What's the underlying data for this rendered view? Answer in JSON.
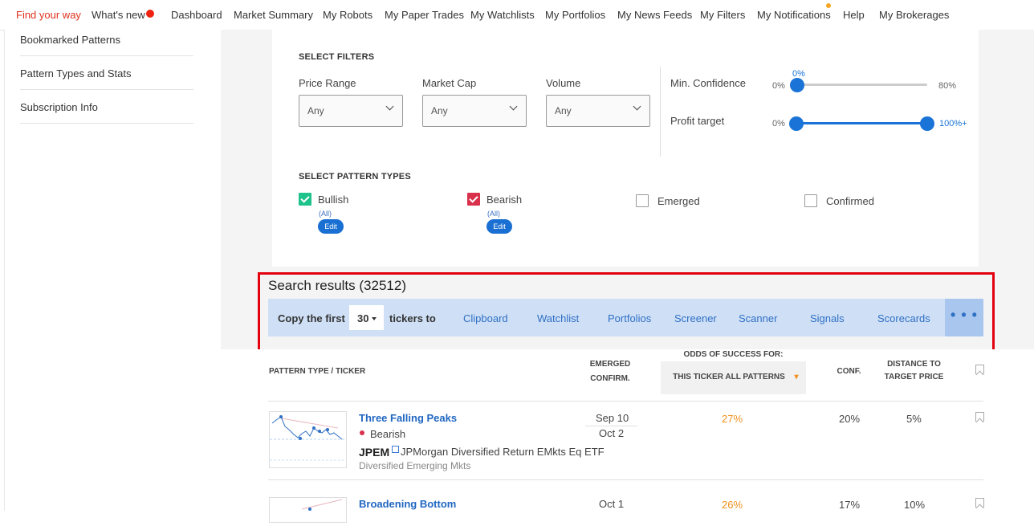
{
  "nav": {
    "items": [
      "Find your way",
      "What's new",
      "Dashboard",
      "Market Summary",
      "My Robots",
      "My Paper Trades",
      "My Watchlists",
      "My Portfolios",
      "My News Feeds",
      "My Filters",
      "My Notifications",
      "Help",
      "My Brokerages"
    ]
  },
  "sidebar": {
    "items": [
      "Bookmarked Patterns",
      "Pattern Types and Stats",
      "Subscription Info"
    ]
  },
  "filters": {
    "title": "SELECT FILTERS",
    "price_range": {
      "label": "Price Range",
      "value": "Any"
    },
    "market_cap": {
      "label": "Market Cap",
      "value": "Any"
    },
    "volume": {
      "label": "Volume",
      "value": "Any"
    },
    "min_confidence": {
      "label": "Min. Confidence",
      "min": "0%",
      "max": "80%",
      "current": "0%",
      "value": 0
    },
    "profit_target": {
      "label": "Profit target",
      "min": "0%",
      "max": "100%+",
      "low": 0,
      "high": 1
    }
  },
  "pattern_types": {
    "title": "SELECT PATTERN TYPES",
    "bullish": {
      "label": "Bullish",
      "sub": "(All)",
      "edit": "Edit",
      "checked": true
    },
    "bearish": {
      "label": "Bearish",
      "sub": "(All)",
      "edit": "Edit",
      "checked": true
    },
    "emerged": {
      "label": "Emerged",
      "checked": false
    },
    "confirmed": {
      "label": "Confirmed",
      "checked": false
    }
  },
  "results": {
    "title": "Search results (32512)",
    "copy": {
      "prefix": "Copy the first",
      "count": "30",
      "suffix": "tickers to",
      "targets": [
        "Clipboard",
        "Watchlist",
        "Portfolios",
        "Screener",
        "Scanner",
        "Signals",
        "Scorecards"
      ],
      "more": "• • •"
    }
  },
  "table": {
    "headers": {
      "pattern": "PATTERN TYPE  / TICKER",
      "emerged": "EMERGED",
      "confirm": "CONFIRM.",
      "odds_title": "ODDS OF SUCCESS FOR:",
      "odds_sub": "THIS TICKER ALL PATTERNS",
      "conf": "CONF.",
      "distance1": "DISTANCE TO",
      "distance2": "TARGET PRICE"
    },
    "rows": [
      {
        "pattern": "Three Falling Peaks",
        "type": "Bearish",
        "ticker": "JPEM",
        "name": "JPMorgan Diversified Return EMkts Eq ETF",
        "category": "Diversified Emerging Mkts",
        "emerged": "Sep 10",
        "confirmed": "Oct 2",
        "odds": "27%",
        "conf": "20%",
        "distance": "5%"
      },
      {
        "pattern": "Broadening Bottom",
        "emerged": "Oct 1",
        "odds": "26%",
        "conf": "17%",
        "distance": "10%"
      }
    ]
  },
  "colors": {
    "accent": "#1a73d6",
    "highlight": "#e3000f",
    "odds": "#f0901d",
    "bullish": "#1ec28b",
    "bearish": "#d9304b"
  }
}
